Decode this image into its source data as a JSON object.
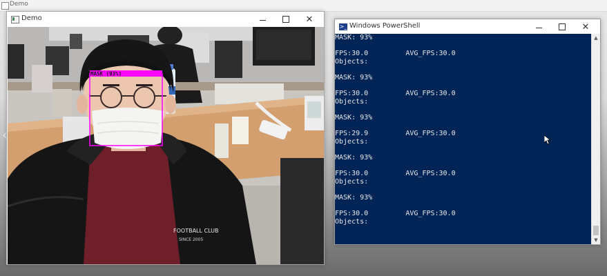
{
  "background_window": {
    "title": "Demo"
  },
  "demo_window": {
    "title": "Demo",
    "detection": {
      "label": "MASK (93%)",
      "color": "#ff00ff"
    },
    "shirt_text": {
      "line1": "FOOTBALL CLUB",
      "line2": "SINCE 2005"
    }
  },
  "powershell_window": {
    "title": "Windows PowerShell",
    "lines": [
      "MASK: 93%",
      "",
      "FPS:30.0         AVG_FPS:30.0",
      "Objects:",
      "",
      "MASK: 93%",
      "",
      "FPS:30.0         AVG_FPS:30.0",
      "Objects:",
      "",
      "MASK: 93%",
      "",
      "FPS:29.9         AVG_FPS:30.0",
      "Objects:",
      "",
      "MASK: 93%",
      "",
      "FPS:30.0         AVG_FPS:30.0",
      "Objects:",
      "",
      "MASK: 93%",
      "",
      "FPS:30.0         AVG_FPS:30.0",
      "Objects:"
    ],
    "bg_color": "#012456"
  },
  "window_controls": {
    "minimize": "—",
    "maximize": "☐",
    "close": "✕"
  }
}
